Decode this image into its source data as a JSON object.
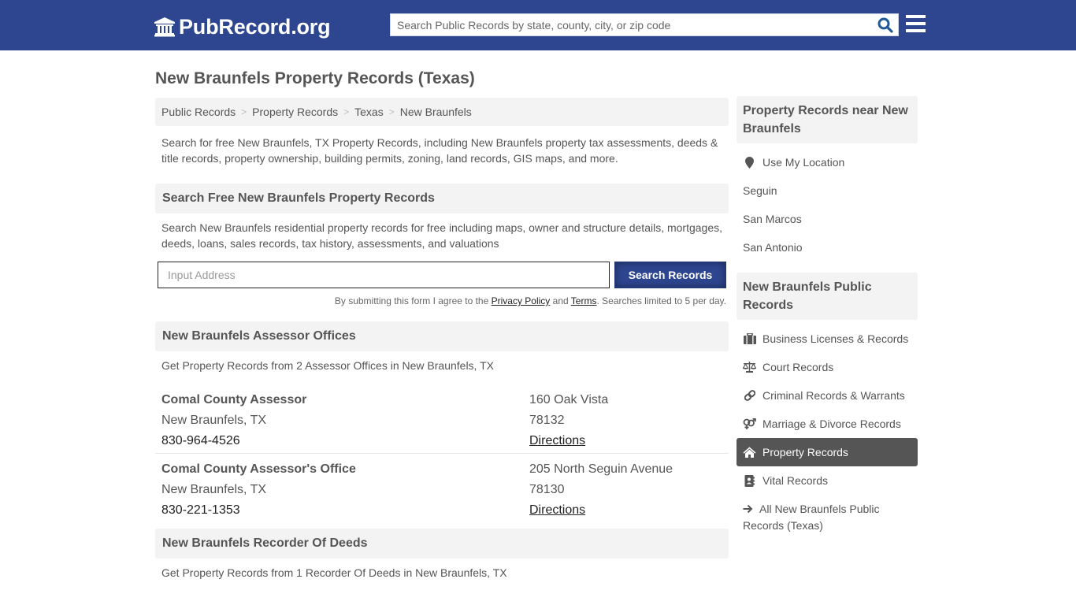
{
  "header": {
    "logo_text": "PubRecord.org",
    "search_placeholder": "Search Public Records by state, county, city, or zip code",
    "search_icon": "search-icon",
    "menu_icon": "hamburger-menu-icon",
    "brand_color": "#2e4690"
  },
  "page": {
    "title": "New Braunfels Property Records (Texas)"
  },
  "breadcrumb": [
    {
      "label": "Public Records"
    },
    {
      "label": "Property Records"
    },
    {
      "label": "Texas"
    },
    {
      "label": "New Braunfels"
    }
  ],
  "intro": "Search for free New Braunfels, TX Property Records, including New Braunfels property tax assessments, deeds & title records, property ownership, building permits, zoning, land records, GIS maps, and more.",
  "search_section": {
    "heading": "Search Free New Braunfels Property Records",
    "description": "Search New Braunfels residential property records for free including maps, owner and structure details, mortgages, deeds, loans, sales records, tax history, assessments, and valuations",
    "input_placeholder": "Input Address",
    "input_value": "",
    "button_label": "Search Records",
    "disclaimer_pre": "By submitting this form I agree to the ",
    "privacy_label": "Privacy Policy",
    "disclaimer_mid": " and ",
    "terms_label": "Terms",
    "disclaimer_post": ". Searches limited to 5 per day."
  },
  "assessor_section": {
    "heading": "New Braunfels Assessor Offices",
    "subtext": "Get Property Records from 2 Assessor Offices in New Braunfels, TX",
    "offices": [
      {
        "name": "Comal County Assessor",
        "city": "New Braunfels, TX",
        "phone": "830-964-4526",
        "address": "160 Oak Vista",
        "zip": "78132",
        "directions_label": "Directions"
      },
      {
        "name": "Comal County Assessor's Office",
        "city": "New Braunfels, TX",
        "phone": "830-221-1353",
        "address": "205 North Seguin Avenue",
        "zip": "78130",
        "directions_label": "Directions"
      }
    ]
  },
  "recorder_section": {
    "heading": "New Braunfels Recorder Of Deeds",
    "subtext": "Get Property Records from 1 Recorder Of Deeds in New Braunfels, TX"
  },
  "sidebar": {
    "nearby": {
      "heading": "Property Records near New Braunfels",
      "items": [
        {
          "label": "Use My Location",
          "icon": "map-marker-icon"
        },
        {
          "label": "Seguin"
        },
        {
          "label": "San Marcos"
        },
        {
          "label": "San Antonio"
        }
      ]
    },
    "public_records": {
      "heading": "New Braunfels Public Records",
      "items": [
        {
          "label": "Business Licenses & Records",
          "icon": "briefcase-icon"
        },
        {
          "label": "Court Records",
          "icon": "balance-scale-icon"
        },
        {
          "label": "Criminal Records & Warrants",
          "icon": "link-icon"
        },
        {
          "label": "Marriage & Divorce Records",
          "icon": "venus-mars-icon"
        },
        {
          "label": "Property Records",
          "icon": "home-icon",
          "active": true
        },
        {
          "label": "Vital Records",
          "icon": "address-book-icon"
        },
        {
          "label": "All New Braunfels Public Records (Texas)",
          "icon": "arrow-right-icon"
        }
      ]
    }
  }
}
